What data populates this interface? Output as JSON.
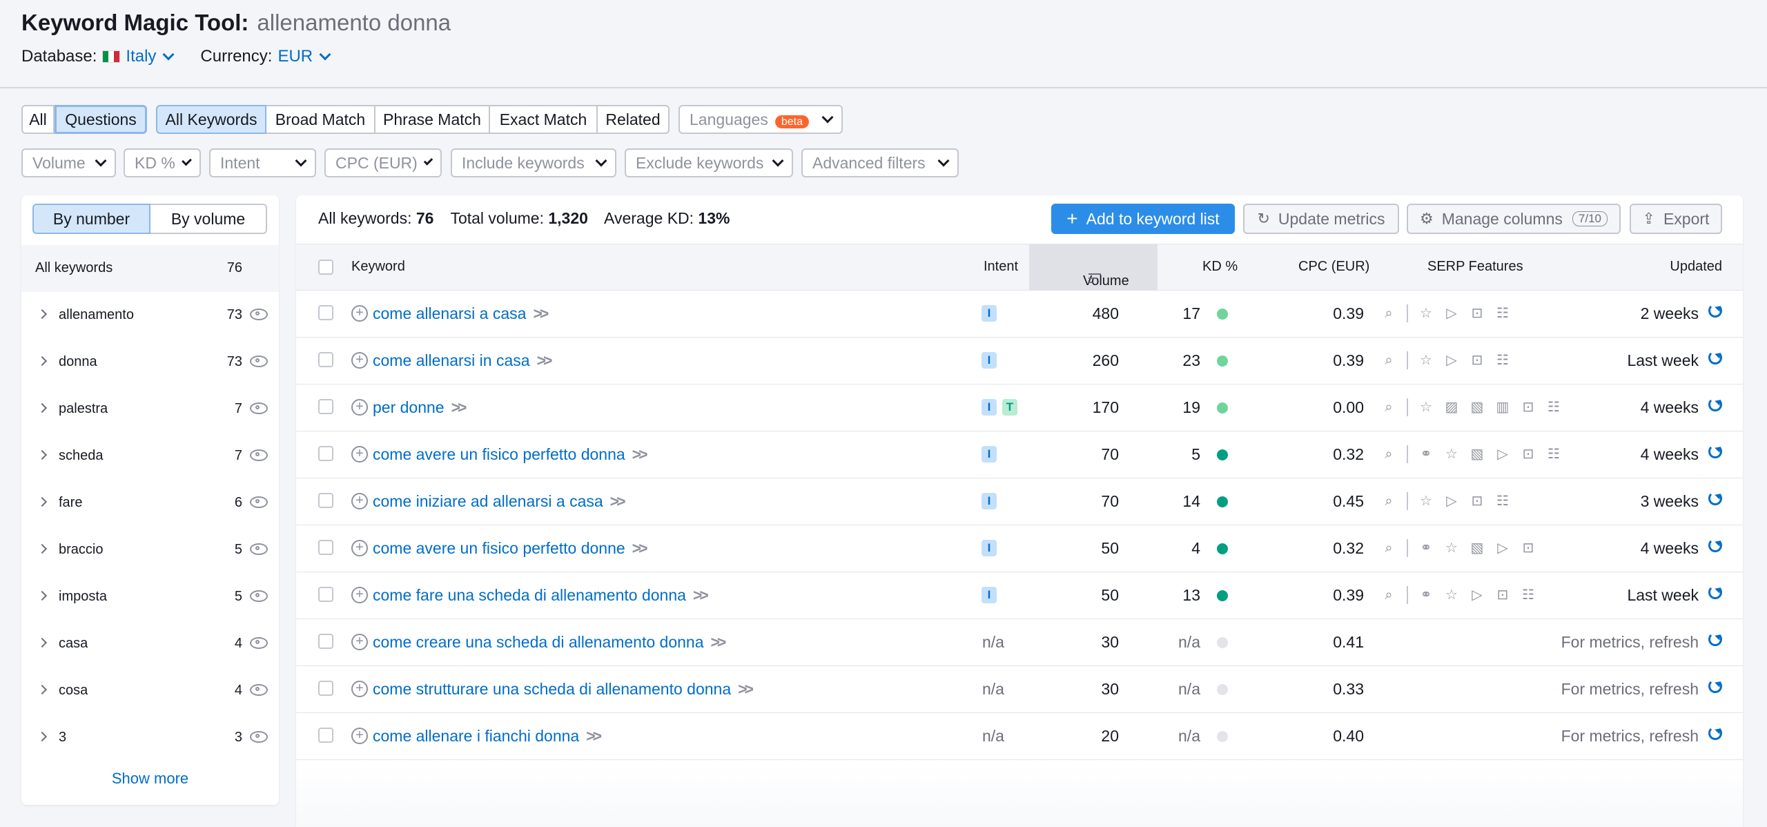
{
  "title": {
    "tool": "Keyword Magic Tool:",
    "query": "allenamento donna"
  },
  "database": {
    "label": "Database:",
    "value": "Italy"
  },
  "currency": {
    "label": "Currency:",
    "value": "EUR"
  },
  "tabs": {
    "all": "All",
    "questions": "Questions",
    "all_keywords": "All Keywords",
    "broad": "Broad Match",
    "phrase": "Phrase Match",
    "exact": "Exact Match",
    "related": "Related",
    "languages": "Languages",
    "beta": "beta"
  },
  "filters": {
    "volume": "Volume",
    "kd": "KD %",
    "intent": "Intent",
    "cpc": "CPC (EUR)",
    "include": "Include keywords",
    "exclude": "Exclude keywords",
    "advanced": "Advanced filters"
  },
  "sidebar": {
    "by_number": "By number",
    "by_volume": "By volume",
    "all_label": "All keywords",
    "all_count": "76",
    "groups": [
      {
        "name": "allenamento",
        "count": "73"
      },
      {
        "name": "donna",
        "count": "73"
      },
      {
        "name": "palestra",
        "count": "7"
      },
      {
        "name": "scheda",
        "count": "7"
      },
      {
        "name": "fare",
        "count": "6"
      },
      {
        "name": "braccio",
        "count": "5"
      },
      {
        "name": "imposta",
        "count": "5"
      },
      {
        "name": "casa",
        "count": "4"
      },
      {
        "name": "cosa",
        "count": "4"
      },
      {
        "name": "3",
        "count": "3"
      }
    ],
    "show_more": "Show more"
  },
  "stats": {
    "all_label": "All keywords:",
    "all_value": "76",
    "vol_label": "Total volume:",
    "vol_value": "1,320",
    "kd_label": "Average KD:",
    "kd_value": "13%"
  },
  "toolbar": {
    "add": "Add to keyword list",
    "update": "Update metrics",
    "manage": "Manage columns",
    "manage_badge": "7/10",
    "export": "Export"
  },
  "columns": {
    "keyword": "Keyword",
    "intent": "Intent",
    "volume": "Volume",
    "kd": "KD %",
    "cpc": "CPC (EUR)",
    "serp": "SERP Features",
    "updated": "Updated"
  },
  "colors": {
    "accent": "#006dca",
    "kd_easy": "#6fd59a",
    "kd_very_easy": "#009f81",
    "kd_na": "#e2e4ea"
  },
  "rows": [
    {
      "keyword": "come allenarsi a casa",
      "intent": [
        "I"
      ],
      "volume": "480",
      "kd": "17",
      "kd_color": "#6fd59a",
      "cpc": "0.39",
      "serp": [
        "snippet-icon",
        "star-icon",
        "video-icon",
        "faq-icon",
        "list-icon"
      ],
      "updated": "2 weeks"
    },
    {
      "keyword": "come allenarsi in casa",
      "intent": [
        "I"
      ],
      "volume": "260",
      "kd": "23",
      "kd_color": "#6fd59a",
      "cpc": "0.39",
      "serp": [
        "snippet-icon",
        "star-icon",
        "video-icon",
        "faq-icon",
        "list-icon"
      ],
      "updated": "Last week"
    },
    {
      "keyword": "per donne",
      "intent": [
        "I",
        "T"
      ],
      "volume": "170",
      "kd": "19",
      "kd_color": "#6fd59a",
      "cpc": "0.00",
      "serp": [
        "snippet-icon",
        "star-icon",
        "image-icon",
        "image-pack-icon",
        "carousel-icon",
        "faq-icon",
        "list-icon"
      ],
      "updated": "4 weeks"
    },
    {
      "keyword": "come avere un fisico perfetto donna",
      "intent": [
        "I"
      ],
      "volume": "70",
      "kd": "5",
      "kd_color": "#009f81",
      "cpc": "0.32",
      "serp": [
        "snippet-icon",
        "link-icon",
        "star-icon",
        "image-pack-icon",
        "video-icon",
        "faq-icon",
        "list-icon"
      ],
      "updated": "4 weeks"
    },
    {
      "keyword": "come iniziare ad allenarsi a casa",
      "intent": [
        "I"
      ],
      "volume": "70",
      "kd": "14",
      "kd_color": "#009f81",
      "cpc": "0.45",
      "serp": [
        "snippet-icon",
        "star-icon",
        "video-icon",
        "faq-icon",
        "list-icon"
      ],
      "updated": "3 weeks"
    },
    {
      "keyword": "come avere un fisico perfetto donne",
      "intent": [
        "I"
      ],
      "volume": "50",
      "kd": "4",
      "kd_color": "#009f81",
      "cpc": "0.32",
      "serp": [
        "snippet-icon",
        "link-icon",
        "star-icon",
        "image-pack-icon",
        "video-icon",
        "faq-icon"
      ],
      "updated": "4 weeks"
    },
    {
      "keyword": "come fare una scheda di allenamento donna",
      "intent": [
        "I"
      ],
      "volume": "50",
      "kd": "13",
      "kd_color": "#009f81",
      "cpc": "0.39",
      "serp": [
        "snippet-icon",
        "link-icon",
        "star-icon",
        "video-icon",
        "faq-icon",
        "list-icon"
      ],
      "updated": "Last week"
    },
    {
      "keyword": "come creare una scheda di allenamento donna",
      "intent_na": "n/a",
      "volume": "30",
      "kd_na": "n/a",
      "kd_color": "#e2e4ea",
      "cpc": "0.41",
      "serp": [],
      "updated": "For metrics, refresh"
    },
    {
      "keyword": "come strutturare una scheda di allenamento donna",
      "intent_na": "n/a",
      "volume": "30",
      "kd_na": "n/a",
      "kd_color": "#e2e4ea",
      "cpc": "0.33",
      "serp": [],
      "updated": "For metrics, refresh"
    },
    {
      "keyword": "come allenare i fianchi donna",
      "intent_na": "n/a",
      "volume": "20",
      "kd_na": "n/a",
      "kd_color": "#e2e4ea",
      "cpc": "0.40",
      "serp": [],
      "updated": "For metrics, refresh"
    }
  ]
}
